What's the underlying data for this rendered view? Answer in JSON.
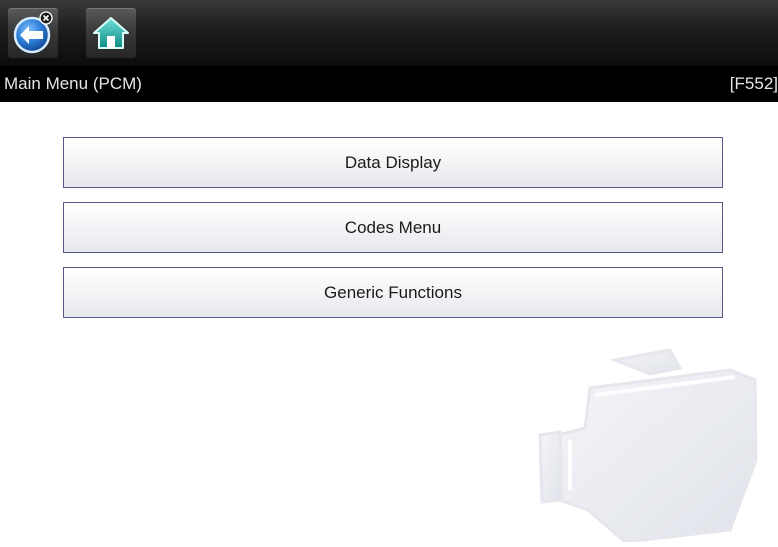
{
  "toolbar": {
    "back_button": {
      "icon": "back-arrow-icon",
      "badge_icon": "close-icon",
      "color": "#2f7fd8"
    },
    "home_button": {
      "icon": "home-icon",
      "color": "#1ea6a0"
    }
  },
  "header": {
    "title": "Main Menu (PCM)",
    "screen_code": "[F552]"
  },
  "menu": {
    "items": [
      {
        "label": "Data Display"
      },
      {
        "label": "Codes Menu"
      },
      {
        "label": "Generic Functions"
      }
    ]
  },
  "decor": {
    "watermark_icon": "engine-icon"
  }
}
